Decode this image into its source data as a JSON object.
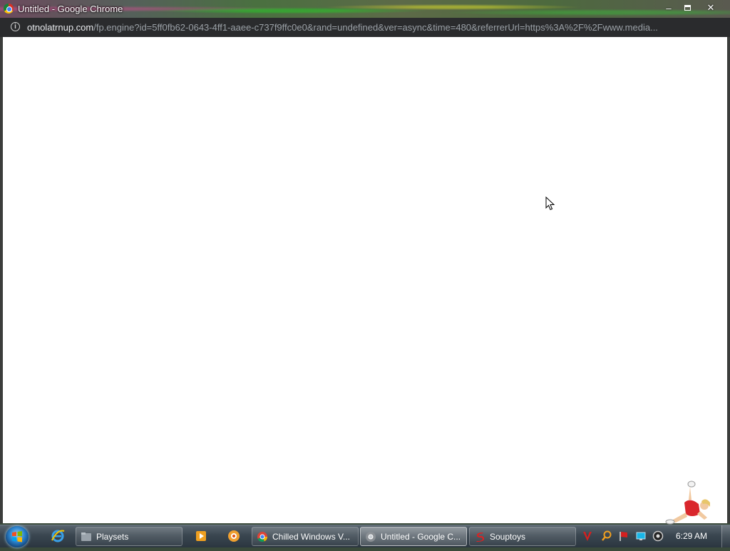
{
  "window": {
    "title": "Untitled - Google Chrome",
    "minimize_icon": "minimize-icon",
    "maximize_icon": "maximize-icon",
    "close_icon": "close-icon"
  },
  "address_bar": {
    "info_icon": "info-icon",
    "url_host": "otnolatrnup.com",
    "url_path": "/fp.engine?id=5ff0fb62-0643-4ff1-aaee-c737f9ffc0e0&rand=undefined&ver=async&time=480&referrerUrl=https%3A%2F%2Fwww.media..."
  },
  "taskbar": {
    "start_icon": "windows-start-icon",
    "quicklaunch": [
      {
        "name": "internet-explorer-icon"
      },
      {
        "name": "media-player-icon"
      },
      {
        "name": "app-icon"
      }
    ],
    "tasks": [
      {
        "label": "Playsets",
        "icon": "folder-icon",
        "active": false
      },
      {
        "label": "Chilled Windows V...",
        "icon": "chrome-icon",
        "active": false
      },
      {
        "label": "Untitled - Google C...",
        "icon": "chrome-icon",
        "active": true
      },
      {
        "label": "Souptoys",
        "icon": "souptoys-icon",
        "active": false
      }
    ],
    "tray": [
      {
        "name": "antivirus-icon"
      },
      {
        "name": "search-tray-icon"
      },
      {
        "name": "flag-icon"
      },
      {
        "name": "network-icon"
      },
      {
        "name": "volume-icon"
      }
    ],
    "clock": "6:29 AM"
  },
  "colors": {
    "title_text": "#ffffff",
    "address_bg": "#2a2b2d",
    "page_bg": "#ffffff",
    "taskbar_bg": "#3a4650"
  }
}
